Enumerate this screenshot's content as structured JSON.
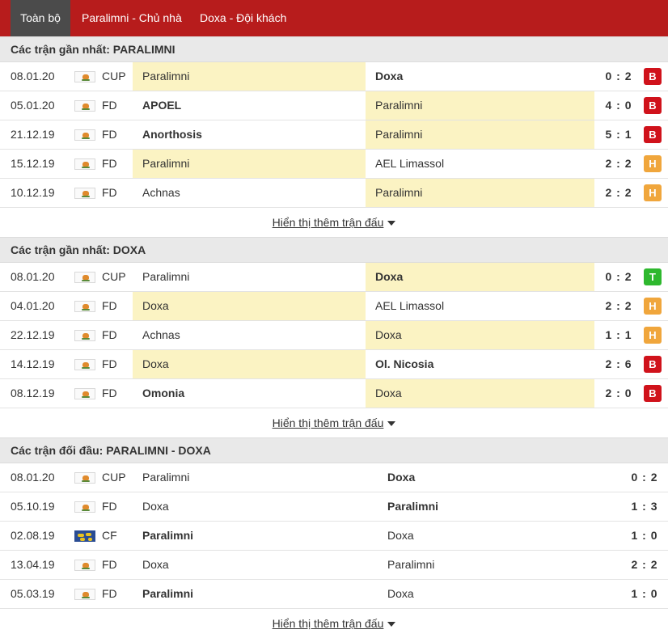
{
  "tabs": [
    {
      "label": "Toàn bộ",
      "active": true
    },
    {
      "label": "Paralimni - Chủ nhà",
      "active": false
    },
    {
      "label": "Doxa - Đội khách",
      "active": false
    }
  ],
  "sections": [
    {
      "title": "Các trận gần nhất: PARALIMNI",
      "show_more": "Hiển thị thêm trận đấu",
      "matches": [
        {
          "date": "08.01.20",
          "comp": "CUP",
          "flag": "cyprus-flag-icon",
          "home": "Paralimni",
          "away": "Doxa",
          "score": "0 : 2",
          "result": "B"
        },
        {
          "date": "05.01.20",
          "comp": "FD",
          "flag": "cyprus-flag-icon",
          "home": "APOEL",
          "away": "Paralimni",
          "score": "4 : 0",
          "result": "B"
        },
        {
          "date": "21.12.19",
          "comp": "FD",
          "flag": "cyprus-flag-icon",
          "home": "Anorthosis",
          "away": "Paralimni",
          "score": "5 : 1",
          "result": "B"
        },
        {
          "date": "15.12.19",
          "comp": "FD",
          "flag": "cyprus-flag-icon",
          "home": "Paralimni",
          "away": "AEL Limassol",
          "score": "2 : 2",
          "result": "H"
        },
        {
          "date": "10.12.19",
          "comp": "FD",
          "flag": "cyprus-flag-icon",
          "home": "Achnas",
          "away": "Paralimni",
          "score": "2 : 2",
          "result": "H"
        }
      ]
    },
    {
      "title": "Các trận gần nhất: DOXA",
      "show_more": "Hiển thị thêm trận đấu",
      "matches": [
        {
          "date": "08.01.20",
          "comp": "CUP",
          "flag": "cyprus-flag-icon",
          "home": "Paralimni",
          "away": "Doxa",
          "score": "0 : 2",
          "result": "T"
        },
        {
          "date": "04.01.20",
          "comp": "FD",
          "flag": "cyprus-flag-icon",
          "home": "Doxa",
          "away": "AEL Limassol",
          "score": "2 : 2",
          "result": "H"
        },
        {
          "date": "22.12.19",
          "comp": "FD",
          "flag": "cyprus-flag-icon",
          "home": "Achnas",
          "away": "Doxa",
          "score": "1 : 1",
          "result": "H"
        },
        {
          "date": "14.12.19",
          "comp": "FD",
          "flag": "cyprus-flag-icon",
          "home": "Doxa",
          "away": "Ol. Nicosia",
          "score": "2 : 6",
          "result": "B"
        },
        {
          "date": "08.12.19",
          "comp": "FD",
          "flag": "cyprus-flag-icon",
          "home": "Omonia",
          "away": "Doxa",
          "score": "2 : 0",
          "result": "B"
        }
      ]
    },
    {
      "title": "Các trận đối đầu: PARALIMNI - DOXA",
      "show_more": "Hiển thị thêm trận đấu",
      "matches": [
        {
          "date": "08.01.20",
          "comp": "CUP",
          "flag": "cyprus-flag-icon",
          "home": "Paralimni",
          "away": "Doxa",
          "score": "0 : 2"
        },
        {
          "date": "05.10.19",
          "comp": "FD",
          "flag": "cyprus-flag-icon",
          "home": "Doxa",
          "away": "Paralimni",
          "score": "1 : 3"
        },
        {
          "date": "02.08.19",
          "comp": "CF",
          "flag": "world-flag-icon",
          "home": "Paralimni",
          "away": "Doxa",
          "score": "1 : 0"
        },
        {
          "date": "13.04.19",
          "comp": "FD",
          "flag": "cyprus-flag-icon",
          "home": "Doxa",
          "away": "Paralimni",
          "score": "2 : 2"
        },
        {
          "date": "05.03.19",
          "comp": "FD",
          "flag": "cyprus-flag-icon",
          "home": "Paralimni",
          "away": "Doxa",
          "score": "1 : 0"
        }
      ]
    }
  ],
  "colors": {
    "tab_bar": "#b71c1c",
    "tab_active": "#4b4b4b",
    "highlight": "#fbf3c3",
    "result_B": "#d0121b",
    "result_H": "#f0a63c",
    "result_T": "#2eb82e"
  }
}
